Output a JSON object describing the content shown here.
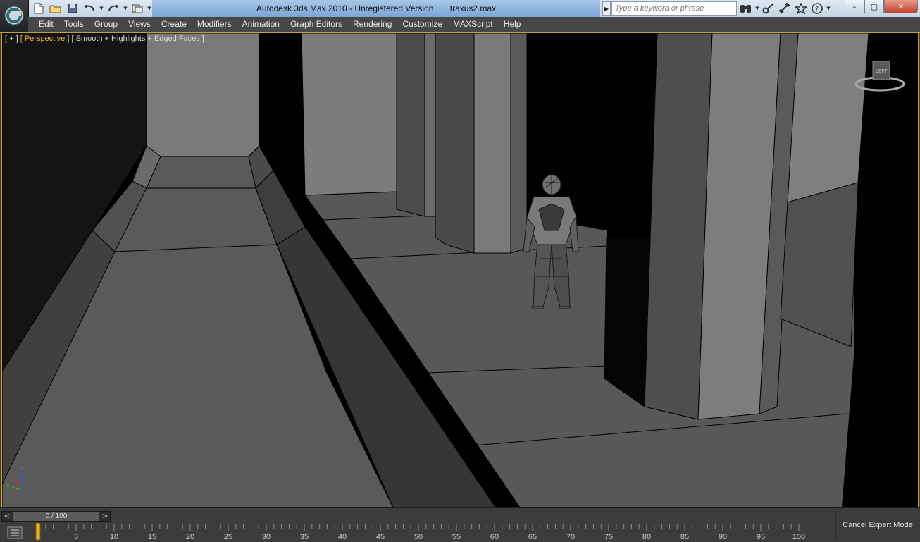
{
  "window": {
    "title": "Autodesk 3ds Max  2010  - Unregistered Version",
    "filename": "traxus2.max",
    "controls": {
      "minimize": "–",
      "maximize": "▢",
      "close": "✕"
    }
  },
  "search": {
    "placeholder": "Type a keyword or phrase",
    "dropdown": "▶"
  },
  "quick_access": {
    "icons": [
      "new-file-icon",
      "open-folder-icon",
      "save-icon",
      "undo-icon",
      "redo-icon",
      "project-folder-icon"
    ]
  },
  "info_tools": {
    "icons": [
      "binoculars-icon",
      "key-icon",
      "satellite-icon",
      "star-icon",
      "help-icon"
    ]
  },
  "menu": {
    "items": [
      "Edit",
      "Tools",
      "Group",
      "Views",
      "Create",
      "Modifiers",
      "Animation",
      "Graph Editors",
      "Rendering",
      "Customize",
      "MAXScript",
      "Help"
    ]
  },
  "viewport": {
    "label_plus": "[ + ]",
    "label_view": "[ Perspective ]",
    "label_shading": "[ Smooth + Highlights + Edged Faces ]",
    "viewcube_face": "LEFT",
    "axis_z": "z",
    "axis_y": "y",
    "axis_x": "x"
  },
  "timeline": {
    "slider_text": "0 / 100",
    "prev": "<",
    "next": ">",
    "ticks": [
      "5",
      "10",
      "15",
      "20",
      "25",
      "30",
      "35",
      "40",
      "45",
      "50",
      "55",
      "60",
      "65",
      "70",
      "75",
      "80",
      "85",
      "90",
      "95",
      "100"
    ],
    "current_frame": 0,
    "total_frames": 100,
    "expert_button": "Cancel Expert Mode"
  },
  "colors": {
    "accent": "#c9a229",
    "title_blue": "#7aa6d4",
    "menu_bg": "#474747"
  }
}
